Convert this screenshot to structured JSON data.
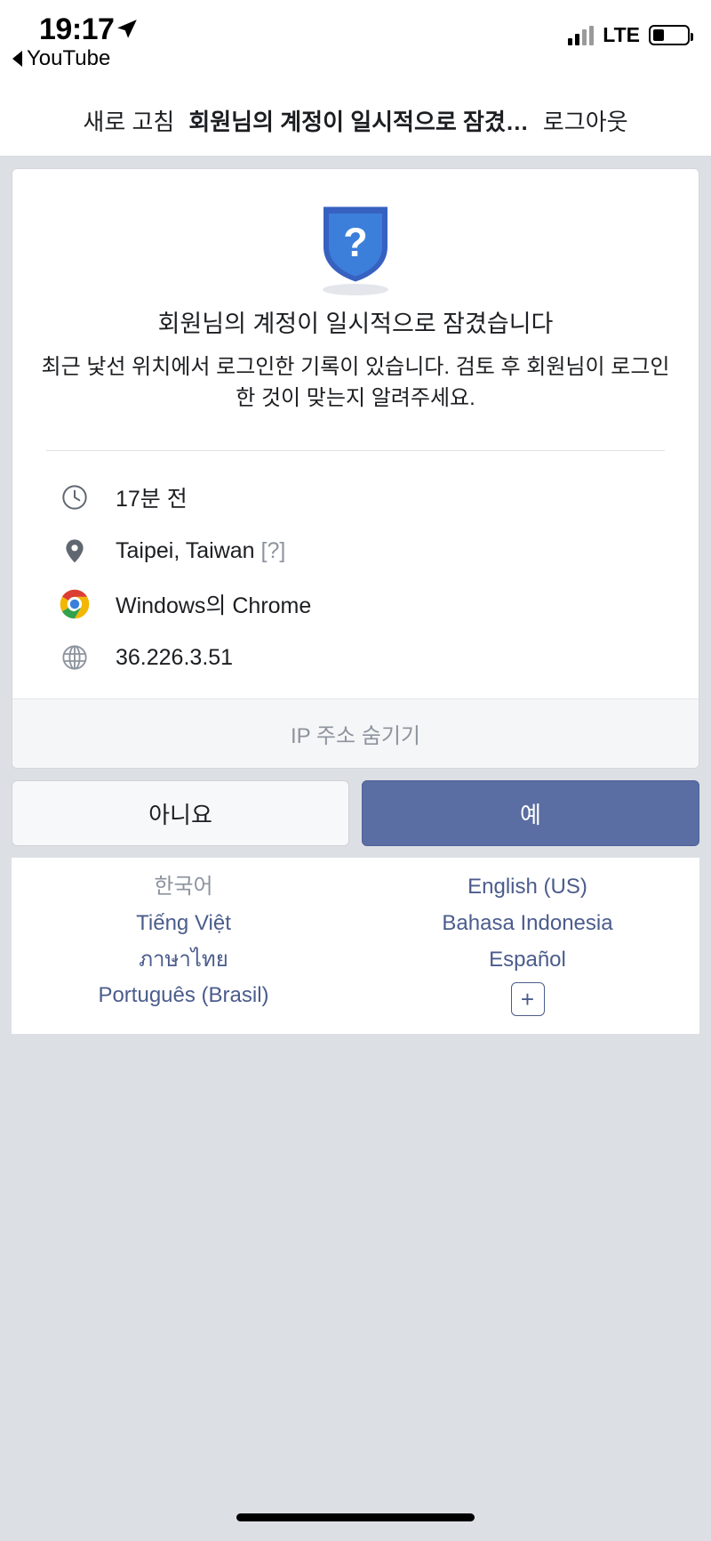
{
  "status_bar": {
    "time": "19:17",
    "back_app": "YouTube",
    "network": "LTE",
    "location_icon": "location-arrow-icon",
    "signal_icon": "signal-bars-icon",
    "battery_icon": "battery-icon"
  },
  "nav_bar": {
    "refresh_label": "새로 고침",
    "title": "회원님의 계정이 일시적으로 잠겼…",
    "logout_label": "로그아웃"
  },
  "card": {
    "shield_icon": "shield-question-icon",
    "headline": "회원님의 계정이 일시적으로 잠겼습니다",
    "subtext": "최근 낯선 위치에서 로그인한 기록이 있습니다. 검토 후 회원님이 로그인한 것이 맞는지 알려주세요.",
    "details": [
      {
        "icon": "clock-icon",
        "text": "17분 전",
        "suffix": ""
      },
      {
        "icon": "location-pin-icon",
        "text": "Taipei, Taiwan",
        "suffix": "[?]"
      },
      {
        "icon": "chrome-icon",
        "text": "Windows의 Chrome",
        "suffix": ""
      },
      {
        "icon": "globe-icon",
        "text": "36.226.3.51",
        "suffix": ""
      }
    ],
    "hide_ip_label": "IP 주소 숨기기"
  },
  "actions": {
    "no_label": "아니요",
    "yes_label": "예",
    "primary_color": "#5b6ea3"
  },
  "languages": {
    "left": [
      {
        "label": "한국어",
        "current": true
      },
      {
        "label": "Tiếng Việt",
        "current": false
      },
      {
        "label": "ภาษาไทย",
        "current": false
      },
      {
        "label": "Português (Brasil)",
        "current": false
      }
    ],
    "right": [
      {
        "label": "English (US)",
        "current": false
      },
      {
        "label": "Bahasa Indonesia",
        "current": false
      },
      {
        "label": "Español",
        "current": false
      }
    ],
    "more_label": "+",
    "link_color": "#4b5c8c"
  }
}
